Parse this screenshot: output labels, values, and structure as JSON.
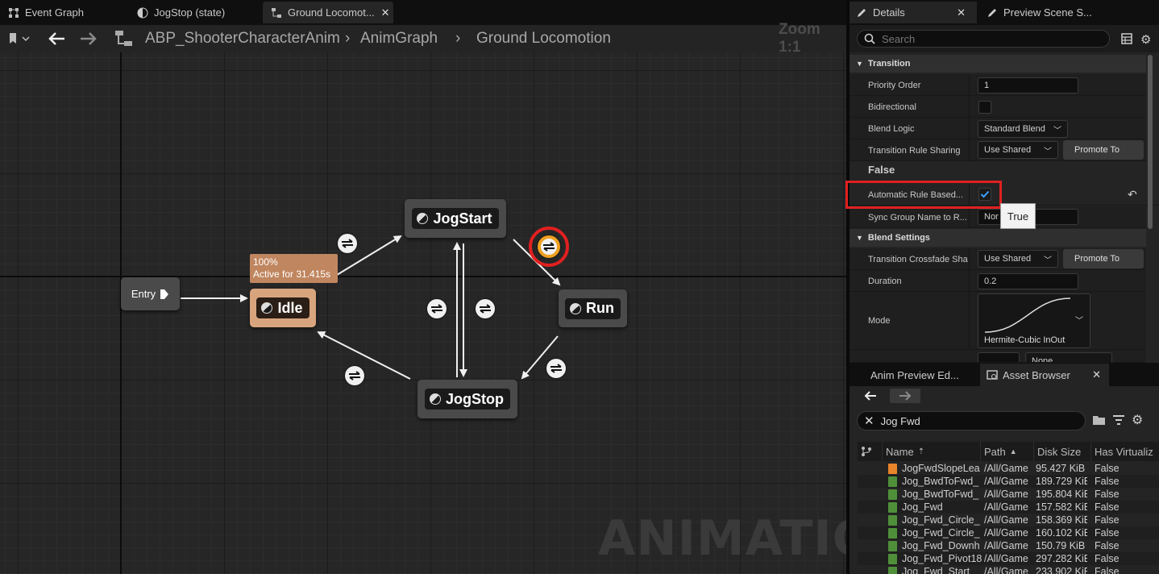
{
  "top_tabs": [
    {
      "label": "Event Graph",
      "icon": "graph-icon"
    },
    {
      "label": "JogStop (state)",
      "icon": "state-icon"
    },
    {
      "label": "Ground Locomot...",
      "icon": "graph-icon",
      "active": true
    }
  ],
  "breadcrumb": {
    "item1": "ABP_ShooterCharacterAnim",
    "item2": "AnimGraph",
    "item3": "Ground Locomotion",
    "zoom": "Zoom 1:1"
  },
  "graph": {
    "entry_label": "Entry",
    "idle_label": "Idle",
    "jogstart_label": "JogStart",
    "run_label": "Run",
    "jogstop_label": "JogStop",
    "idle_weight": "100%",
    "idle_active": "Active for 31.415s",
    "watermark": "ANIMATION",
    "idle_color": "#d8a47e",
    "highlight_color": "#e02020",
    "selected_transition_color": "#f0a020"
  },
  "details": {
    "tab_details": "Details",
    "tab_preview": "Preview Scene S...",
    "search_placeholder": "Search",
    "section_transition": "Transition",
    "priority_order_label": "Priority Order",
    "priority_order_value": "1",
    "bidirectional_label": "Bidirectional",
    "blend_logic_label": "Blend Logic",
    "blend_logic_value": "Standard Blend",
    "rule_sharing_label": "Transition Rule Sharing",
    "rule_sharing_value": "Use Shared",
    "promote_to": "Promote To",
    "false_text": "False",
    "auto_rule_label": "Automatic Rule Based...",
    "sync_group_label": "Sync Group Name to R...",
    "sync_group_value": "Nor",
    "tooltip_true": "True",
    "section_blend": "Blend Settings",
    "crossfade_label": "Transition Crossfade Sha",
    "crossfade_value": "Use Shared",
    "promote_to_2": "Promote To",
    "duration_label": "Duration",
    "duration_value": "0.2",
    "mode_label": "Mode",
    "mode_value": "Hermite-Cubic InOut",
    "partial_value": "None"
  },
  "assets": {
    "tab_preview": "Anim Preview Ed...",
    "tab_browser": "Asset Browser",
    "search_value": "Jog Fwd",
    "columns": [
      "Name",
      "Path",
      "Disk Size",
      "Has Virtualiz"
    ],
    "rows": [
      {
        "name": "JogFwdSlopeLea",
        "path": "/All/Game",
        "size": "95.427 KiB",
        "virt": "False",
        "icon": "orange"
      },
      {
        "name": "Jog_BwdToFwd_",
        "path": "/All/Game",
        "size": "189.729 KiE",
        "virt": "False",
        "icon": "green"
      },
      {
        "name": "Jog_BwdToFwd_",
        "path": "/All/Game",
        "size": "195.804 KiE",
        "virt": "False",
        "icon": "green"
      },
      {
        "name": "Jog_Fwd",
        "path": "/All/Game",
        "size": "157.582 KiE",
        "virt": "False",
        "icon": "green"
      },
      {
        "name": "Jog_Fwd_Circle_",
        "path": "/All/Game",
        "size": "158.369 KiE",
        "virt": "False",
        "icon": "green"
      },
      {
        "name": "Jog_Fwd_Circle_",
        "path": "/All/Game",
        "size": "160.102 KiE",
        "virt": "False",
        "icon": "green"
      },
      {
        "name": "Jog_Fwd_Downh",
        "path": "/All/Game",
        "size": "150.79 KiB",
        "virt": "False",
        "icon": "green"
      },
      {
        "name": "Jog_Fwd_Pivot18",
        "path": "/All/Game",
        "size": "297.282 KiE",
        "virt": "False",
        "icon": "green"
      },
      {
        "name": "Jog_Fwd_Start_",
        "path": "/All/Game",
        "size": "233.902 KiE",
        "virt": "False",
        "icon": "green"
      }
    ]
  }
}
